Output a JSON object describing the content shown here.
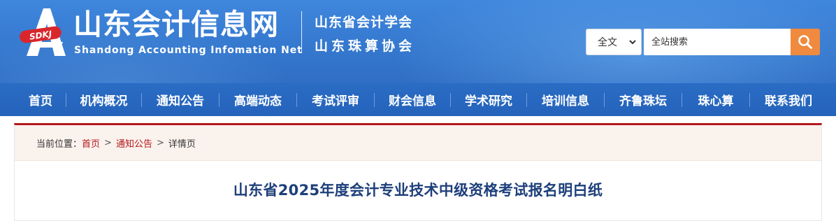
{
  "header": {
    "site_name": "山东会计信息网",
    "site_name_en": "Shandong Accounting Infomation Net",
    "logo_badge": "SDKJ",
    "association_1": "山东省会计学会",
    "association_2": "山东珠算协会",
    "colors": {
      "banner": "#3579cf",
      "accent": "#f08a3e",
      "logo_red": "#d9262c"
    }
  },
  "search": {
    "scope_selected": "全文",
    "placeholder": "全站搜索",
    "button_icon": "search-icon"
  },
  "nav": {
    "items": [
      {
        "label": "首页"
      },
      {
        "label": "机构概况"
      },
      {
        "label": "通知公告"
      },
      {
        "label": "高端动态"
      },
      {
        "label": "考试评审"
      },
      {
        "label": "财会信息"
      },
      {
        "label": "学术研究"
      },
      {
        "label": "培训信息"
      },
      {
        "label": "齐鲁珠坛"
      },
      {
        "label": "珠心算"
      },
      {
        "label": "联系我们"
      }
    ]
  },
  "breadcrumb": {
    "prefix": "当前位置：",
    "home": "首页",
    "section": "通知公告",
    "current": "详情页",
    "separator": ">"
  },
  "article": {
    "title": "山东省2025年度会计专业技术中级资格考试报名明白纸"
  }
}
